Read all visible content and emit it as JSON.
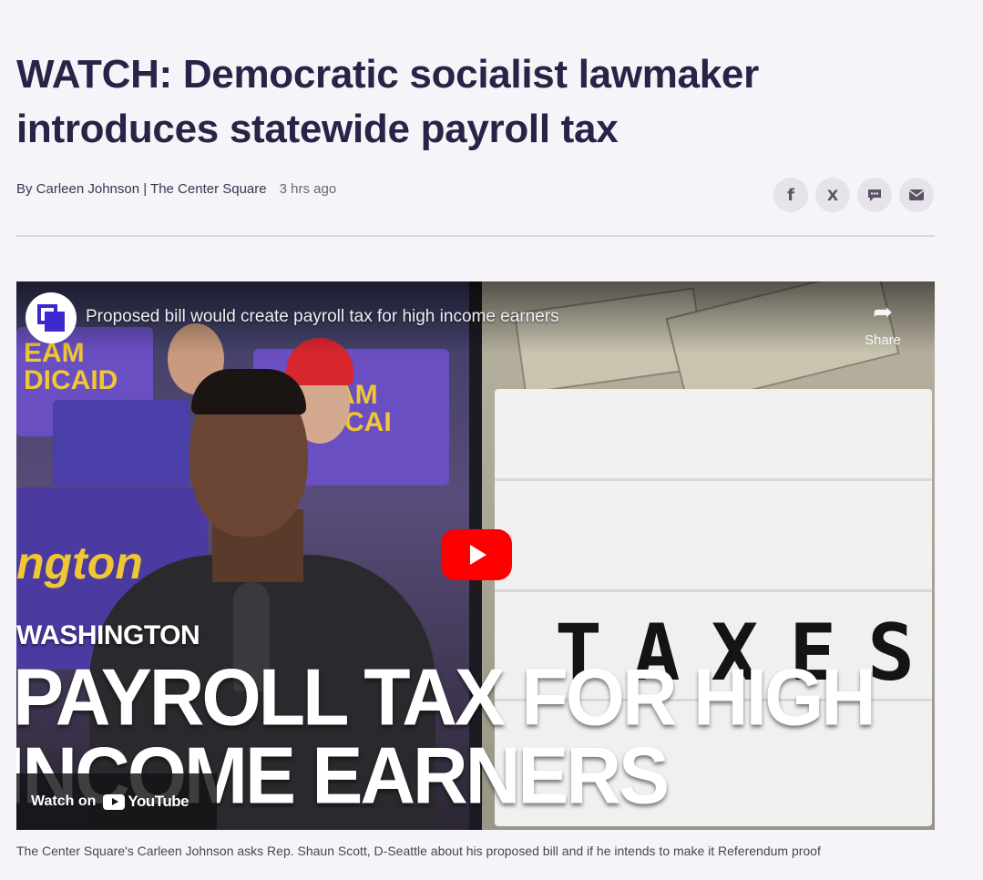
{
  "article": {
    "headline_line1": "WATCH: Democratic socialist lawmaker",
    "headline_line2": "introduces statewide payroll tax",
    "author": "By Carleen Johnson | The Center Square",
    "time": "3 hrs ago",
    "share": [
      {
        "icon": "facebook-icon",
        "glyph": "f"
      },
      {
        "icon": "x-icon",
        "glyph": "𝕏"
      },
      {
        "icon": "sms-icon",
        "glyph": "💬"
      },
      {
        "icon": "email-icon",
        "glyph": "✉"
      }
    ]
  },
  "video": {
    "title": "Proposed bill would create payroll tax for high income earners",
    "share_label": "Share",
    "watch_on": "Watch on",
    "youtube_label": "YouTube",
    "overlay": {
      "state": "WASHINGTON",
      "line1": "PAYROLL TAX FOR HIGH",
      "line2": "INCOME EARNERS"
    },
    "lightbox_word": "TAXES",
    "sign_text_1": "EAM\nDICAID",
    "sign_text_2": "ngton"
  },
  "caption": "The Center Square's Carleen Johnson asks Rep. Shaun Scott, D-Seattle about his proposed bill and if he intends to make it Referendum proof",
  "colors": {
    "headline": "#2b2247",
    "youtube_red": "#ff0000",
    "sign_purple": "#6a4fc2",
    "sign_yellow": "#f1c634"
  }
}
